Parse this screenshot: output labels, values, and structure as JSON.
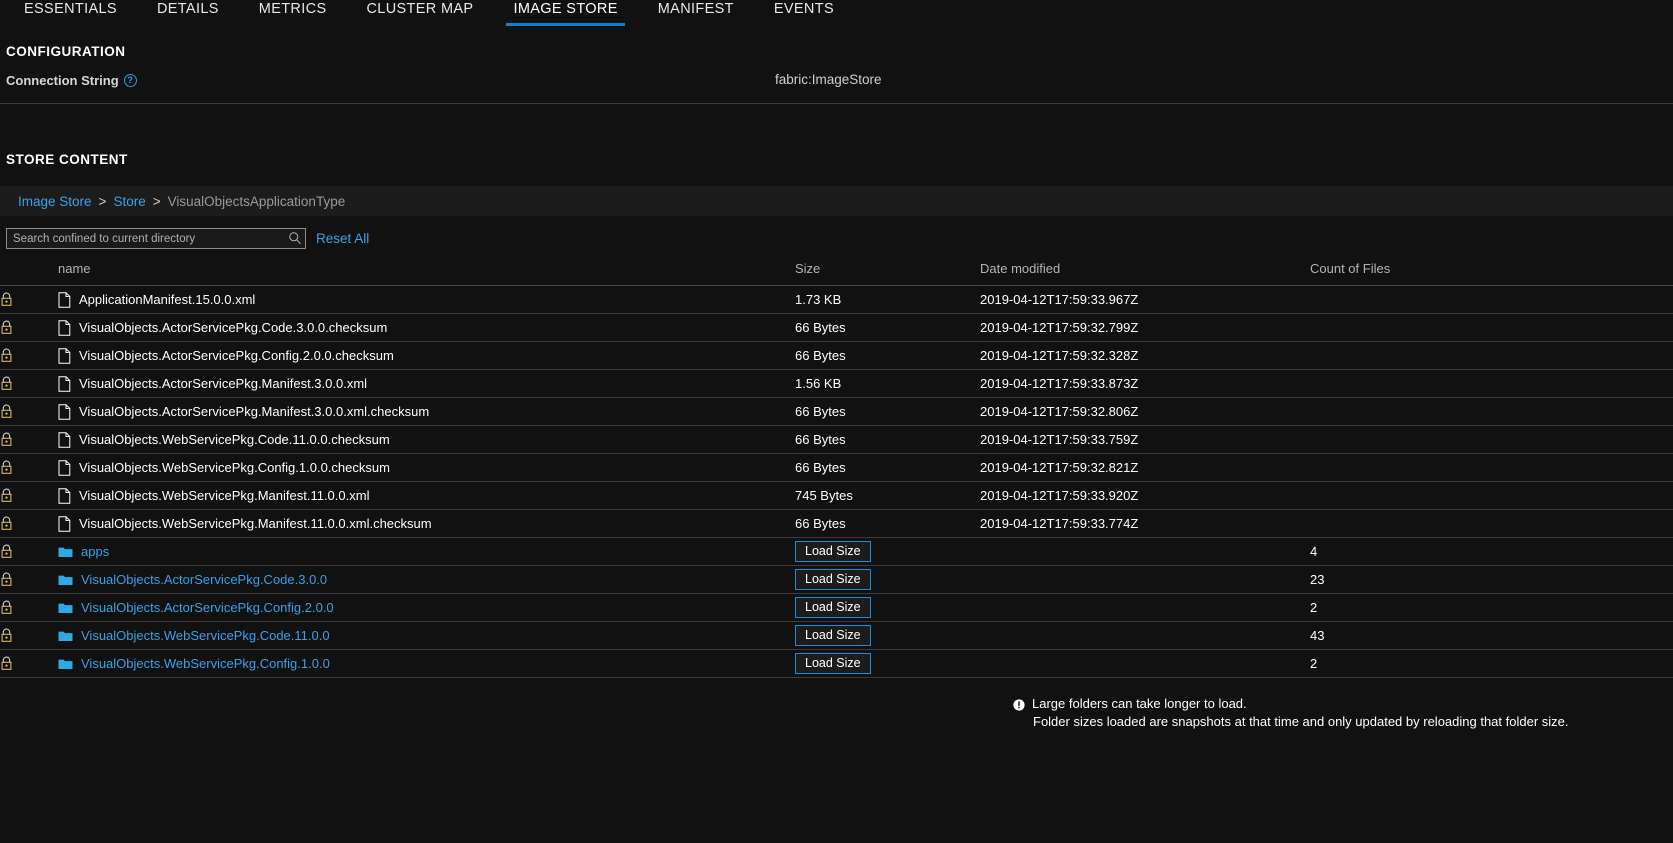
{
  "tabs": [
    {
      "label": "ESSENTIALS",
      "active": false
    },
    {
      "label": "DETAILS",
      "active": false
    },
    {
      "label": "METRICS",
      "active": false
    },
    {
      "label": "CLUSTER MAP",
      "active": false
    },
    {
      "label": "IMAGE STORE",
      "active": true
    },
    {
      "label": "MANIFEST",
      "active": false
    },
    {
      "label": "EVENTS",
      "active": false
    }
  ],
  "configuration": {
    "heading": "CONFIGURATION",
    "connection_string_label": "Connection String",
    "help_icon": "question-mark-icon",
    "connection_string_value": "fabric:ImageStore"
  },
  "store_content": {
    "heading": "STORE CONTENT",
    "breadcrumb": {
      "items": [
        {
          "label": "Image Store",
          "link": true
        },
        {
          "label": "Store",
          "link": true
        },
        {
          "label": "VisualObjectsApplicationType",
          "link": false
        }
      ],
      "separator": ">"
    },
    "search": {
      "placeholder": "Search confined to current directory",
      "value": "",
      "icon": "search-icon"
    },
    "reset_all_label": "Reset All",
    "columns": {
      "name": "name",
      "size": "Size",
      "date_modified": "Date modified",
      "count_of_files": "Count of Files"
    },
    "load_size_label": "Load Size",
    "rows": [
      {
        "type": "file",
        "lock": "lock-icon",
        "name": "ApplicationManifest.15.0.0.xml",
        "size": "1.73 KB",
        "date": "2019-04-12T17:59:33.967Z",
        "count": ""
      },
      {
        "type": "file",
        "lock": "lock-icon",
        "name": "VisualObjects.ActorServicePkg.Code.3.0.0.checksum",
        "size": "66 Bytes",
        "date": "2019-04-12T17:59:32.799Z",
        "count": ""
      },
      {
        "type": "file",
        "lock": "lock-icon",
        "name": "VisualObjects.ActorServicePkg.Config.2.0.0.checksum",
        "size": "66 Bytes",
        "date": "2019-04-12T17:59:32.328Z",
        "count": ""
      },
      {
        "type": "file",
        "lock": "lock-icon",
        "name": "VisualObjects.ActorServicePkg.Manifest.3.0.0.xml",
        "size": "1.56 KB",
        "date": "2019-04-12T17:59:33.873Z",
        "count": ""
      },
      {
        "type": "file",
        "lock": "lock-icon",
        "name": "VisualObjects.ActorServicePkg.Manifest.3.0.0.xml.checksum",
        "size": "66 Bytes",
        "date": "2019-04-12T17:59:32.806Z",
        "count": ""
      },
      {
        "type": "file",
        "lock": "lock-icon",
        "name": "VisualObjects.WebServicePkg.Code.11.0.0.checksum",
        "size": "66 Bytes",
        "date": "2019-04-12T17:59:33.759Z",
        "count": ""
      },
      {
        "type": "file",
        "lock": "lock-icon",
        "name": "VisualObjects.WebServicePkg.Config.1.0.0.checksum",
        "size": "66 Bytes",
        "date": "2019-04-12T17:59:32.821Z",
        "count": ""
      },
      {
        "type": "file",
        "lock": "lock-icon",
        "name": "VisualObjects.WebServicePkg.Manifest.11.0.0.xml",
        "size": "745 Bytes",
        "date": "2019-04-12T17:59:33.920Z",
        "count": ""
      },
      {
        "type": "file",
        "lock": "lock-icon",
        "name": "VisualObjects.WebServicePkg.Manifest.11.0.0.xml.checksum",
        "size": "66 Bytes",
        "date": "2019-04-12T17:59:33.774Z",
        "count": ""
      },
      {
        "type": "folder",
        "lock": "lock-icon",
        "name": "apps",
        "size": "Load Size",
        "date": "",
        "count": "4"
      },
      {
        "type": "folder",
        "lock": "lock-icon",
        "name": "VisualObjects.ActorServicePkg.Code.3.0.0",
        "size": "Load Size",
        "date": "",
        "count": "23"
      },
      {
        "type": "folder",
        "lock": "lock-icon",
        "name": "VisualObjects.ActorServicePkg.Config.2.0.0",
        "size": "Load Size",
        "date": "",
        "count": "2"
      },
      {
        "type": "folder",
        "lock": "lock-icon",
        "name": "VisualObjects.WebServicePkg.Code.11.0.0",
        "size": "Load Size",
        "date": "",
        "count": "43"
      },
      {
        "type": "folder",
        "lock": "lock-icon",
        "name": "VisualObjects.WebServicePkg.Config.1.0.0",
        "size": "Load Size",
        "date": "",
        "count": "2"
      }
    ],
    "footer_note": {
      "icon": "exclamation-icon",
      "line1": "Large folders can take longer to load.",
      "line2": "Folder sizes loaded are snapshots at that time and only updated by reloading that folder size."
    }
  },
  "colors": {
    "background": "#111111",
    "accent_blue": "#0f7fd4",
    "link_blue": "#3aa0e8",
    "folder_icon_blue": "#2fa8e8"
  }
}
